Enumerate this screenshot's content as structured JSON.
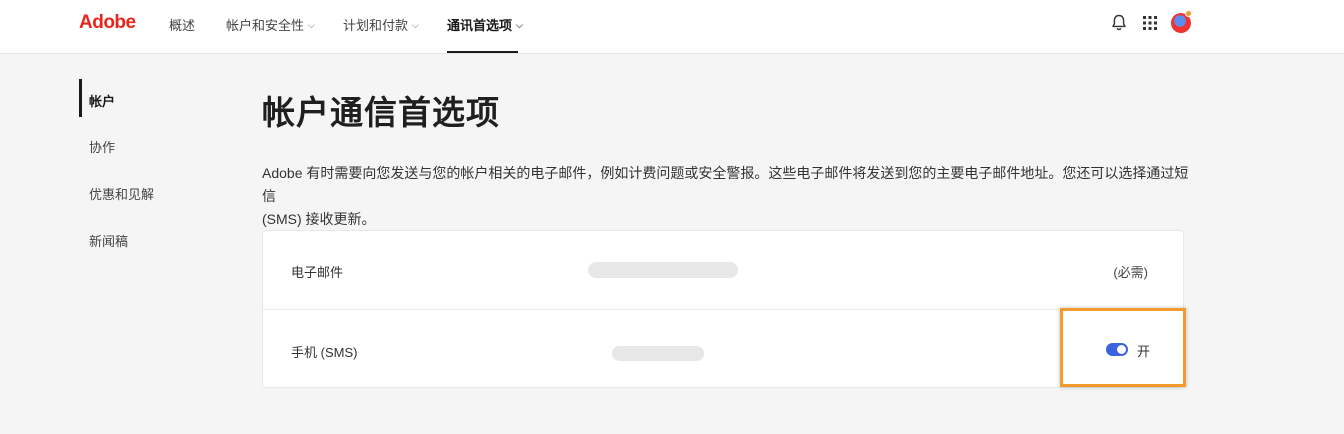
{
  "header": {
    "logo": "Adobe",
    "nav": [
      {
        "label": "概述",
        "has_chevron": false
      },
      {
        "label": "帐户和安全性",
        "has_chevron": true
      },
      {
        "label": "计划和付款",
        "has_chevron": true
      },
      {
        "label": "通讯首选项",
        "has_chevron": true,
        "active": true
      }
    ],
    "chevron": "⌵",
    "icons": [
      "bell-icon",
      "apps-grid-icon",
      "avatar"
    ]
  },
  "sidebar": {
    "items": [
      {
        "label": "帐户",
        "active": true
      },
      {
        "label": "协作"
      },
      {
        "label": "优惠和见解"
      },
      {
        "label": "新闻稿"
      }
    ]
  },
  "main": {
    "title": "帐户通信首选项",
    "intro_line1": "Adobe 有时需要向您发送与您的帐户相关的电子邮件，例如计费问题或安全警报。这些电子邮件将发送到您的主要电子邮件地址。您还可以选择通过短信",
    "intro_line2": "(SMS) 接收更新。",
    "rows": [
      {
        "label": "电子邮件",
        "status": "(必需)"
      },
      {
        "label": "手机 (SMS)",
        "toggle_on": true,
        "toggle_label": "开"
      }
    ]
  },
  "colors": {
    "brand": "#e8261b",
    "toggle": "#3b63e0",
    "highlight": "#f29a2e"
  }
}
